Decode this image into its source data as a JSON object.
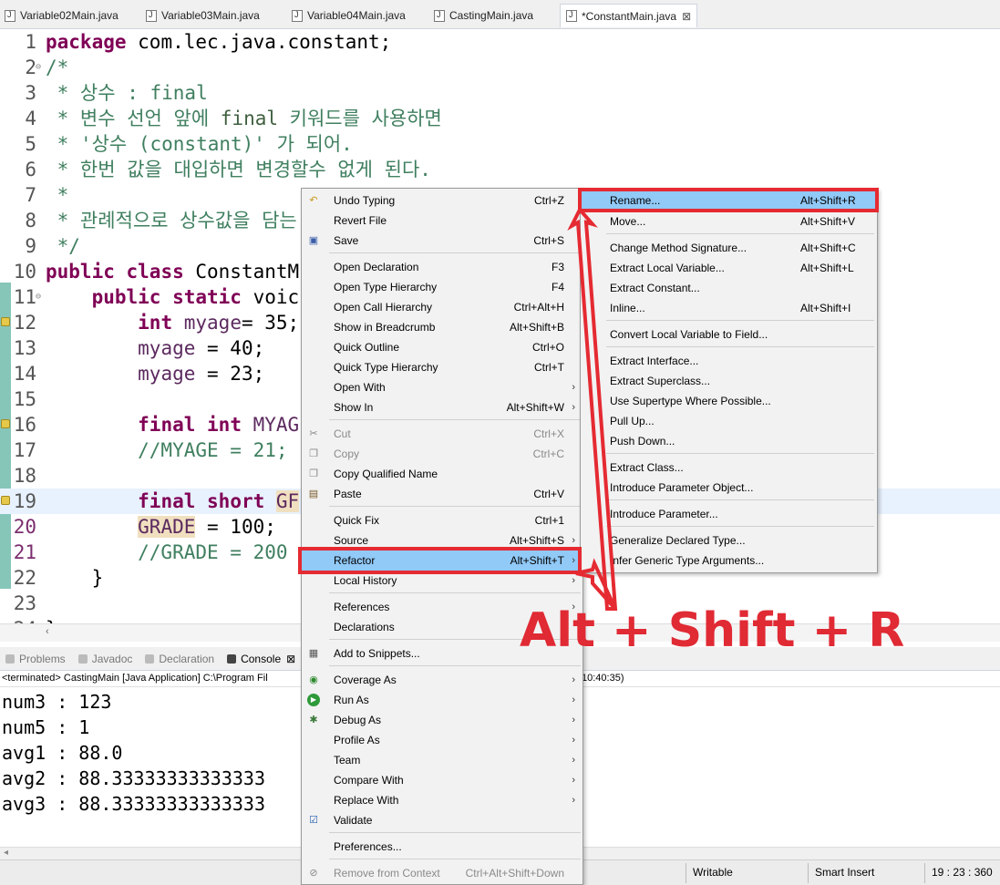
{
  "tabs": [
    {
      "label": "Variable02Main.java"
    },
    {
      "label": "Variable03Main.java"
    },
    {
      "label": "Variable04Main.java"
    },
    {
      "label": "CastingMain.java"
    },
    {
      "label": "*ConstantMain.java",
      "close": "⊠"
    }
  ],
  "editor": {
    "lines": [
      {
        "n": "1",
        "text": "package com.lec.java.constant;"
      },
      {
        "n": "2",
        "text": "/*"
      },
      {
        "n": "3",
        "text": " * 상수 : final"
      },
      {
        "n": "4",
        "text": " * 변수 선언 앞에 final 키워드를 사용하면"
      },
      {
        "n": "5",
        "text": " * '상수 (constant)' 가 되어."
      },
      {
        "n": "6",
        "text": " * 한번 값을 대입하면 변경할수 없게 된다."
      },
      {
        "n": "7",
        "text": " *"
      },
      {
        "n": "8",
        "text": " * 관례적으로 상수값을 담는 상"
      },
      {
        "n": "9",
        "text": " */"
      },
      {
        "n": "10",
        "text": "public class ConstantM"
      },
      {
        "n": "11",
        "text": "    public static voic"
      },
      {
        "n": "12",
        "text": "        int myage= 35;"
      },
      {
        "n": "13",
        "text": "        myage = 40;"
      },
      {
        "n": "14",
        "text": "        myage = 23;"
      },
      {
        "n": "15",
        "text": ""
      },
      {
        "n": "16",
        "text": "        final int MYAG"
      },
      {
        "n": "17",
        "text": "        //MYAGE = 21;"
      },
      {
        "n": "18",
        "text": ""
      },
      {
        "n": "19",
        "text": "        final short GF"
      },
      {
        "n": "20",
        "text": "        GRADE = 100;"
      },
      {
        "n": "21",
        "text": "        //GRADE = 200"
      },
      {
        "n": "22",
        "text": "    }"
      },
      {
        "n": "23",
        "text": ""
      },
      {
        "n": "24",
        "text": "}"
      }
    ],
    "fold_marker": "⊖"
  },
  "views": {
    "tabs": [
      {
        "label": "Problems"
      },
      {
        "label": "Javadoc"
      },
      {
        "label": "Declaration"
      },
      {
        "label": "Console",
        "close": "⊠"
      }
    ]
  },
  "console": {
    "header": "<terminated> CastingMain [Java Application] C:\\Program Fil",
    "header_tail": "10:40:35)",
    "lines": [
      "num3 : 123",
      "num5 : 1",
      "avg1 : 88.0",
      "avg2 : 88.33333333333333",
      "avg3 : 88.33333333333333"
    ]
  },
  "context_menu": {
    "items": [
      {
        "label": "Undo Typing",
        "accel": "Ctrl+Z",
        "icon": "undo-icon"
      },
      {
        "label": "Revert File",
        "accel": ""
      },
      {
        "label": "Save",
        "accel": "Ctrl+S",
        "icon": "save-icon"
      },
      {
        "label": "Open Declaration",
        "accel": "F3"
      },
      {
        "label": "Open Type Hierarchy",
        "accel": "F4"
      },
      {
        "label": "Open Call Hierarchy",
        "accel": "Ctrl+Alt+H"
      },
      {
        "label": "Show in Breadcrumb",
        "accel": "Alt+Shift+B"
      },
      {
        "label": "Quick Outline",
        "accel": "Ctrl+O"
      },
      {
        "label": "Quick Type Hierarchy",
        "accel": "Ctrl+T"
      },
      {
        "label": "Open With",
        "accel": ""
      },
      {
        "label": "Show In",
        "accel": "Alt+Shift+W"
      },
      {
        "label": "Cut",
        "accel": "Ctrl+X",
        "disabled": true,
        "icon": "cut-icon"
      },
      {
        "label": "Copy",
        "accel": "Ctrl+C",
        "disabled": true,
        "icon": "copy-icon"
      },
      {
        "label": "Copy Qualified Name",
        "accel": "",
        "icon": "copy-qualified-icon"
      },
      {
        "label": "Paste",
        "accel": "Ctrl+V",
        "icon": "paste-icon"
      },
      {
        "label": "Quick Fix",
        "accel": "Ctrl+1"
      },
      {
        "label": "Source",
        "accel": "Alt+Shift+S"
      },
      {
        "label": "Refactor",
        "accel": "Alt+Shift+T"
      },
      {
        "label": "Local History",
        "accel": ""
      },
      {
        "label": "References",
        "accel": ""
      },
      {
        "label": "Declarations",
        "accel": ""
      },
      {
        "label": "Add to Snippets...",
        "accel": "",
        "icon": "snippet-icon"
      },
      {
        "label": "Coverage As",
        "accel": "",
        "icon": "coverage-icon"
      },
      {
        "label": "Run As",
        "accel": "",
        "icon": "run-icon"
      },
      {
        "label": "Debug As",
        "accel": "",
        "icon": "debug-icon"
      },
      {
        "label": "Profile As",
        "accel": ""
      },
      {
        "label": "Team",
        "accel": ""
      },
      {
        "label": "Compare With",
        "accel": ""
      },
      {
        "label": "Replace With",
        "accel": ""
      },
      {
        "label": "Validate",
        "accel": "",
        "icon": "check-icon"
      },
      {
        "label": "Preferences...",
        "accel": ""
      },
      {
        "label": "Remove from Context",
        "accel": "Ctrl+Alt+Shift+Down",
        "disabled": true,
        "icon": "remove-context-icon"
      }
    ],
    "submenu_arrow": "›"
  },
  "refactor_menu": {
    "items": [
      {
        "label": "Rename...",
        "accel": "Alt+Shift+R"
      },
      {
        "label": "Move...",
        "accel": "Alt+Shift+V"
      },
      {
        "label": "Change Method Signature...",
        "accel": "Alt+Shift+C"
      },
      {
        "label": "Extract Local Variable...",
        "accel": "Alt+Shift+L"
      },
      {
        "label": "Extract Constant...",
        "accel": ""
      },
      {
        "label": "Inline...",
        "accel": "Alt+Shift+I"
      },
      {
        "label": "Convert Local Variable to Field...",
        "accel": ""
      },
      {
        "label": "Extract Interface...",
        "accel": ""
      },
      {
        "label": "Extract Superclass...",
        "accel": ""
      },
      {
        "label": "Use Supertype Where Possible...",
        "accel": ""
      },
      {
        "label": "Pull Up...",
        "accel": ""
      },
      {
        "label": "Push Down...",
        "accel": ""
      },
      {
        "label": "Extract Class...",
        "accel": ""
      },
      {
        "label": "Introduce Parameter Object...",
        "accel": ""
      },
      {
        "label": "Introduce Parameter...",
        "accel": ""
      },
      {
        "label": "Generalize Declared Type...",
        "accel": ""
      },
      {
        "label": "Infer Generic Type Arguments...",
        "accel": ""
      }
    ]
  },
  "annotation": {
    "text": "Alt + Shift + R",
    "color": "#e52a32"
  },
  "status_bar": {
    "writable": "Writable",
    "insert_mode": "Smart Insert",
    "position": "19 : 23 : 360"
  }
}
